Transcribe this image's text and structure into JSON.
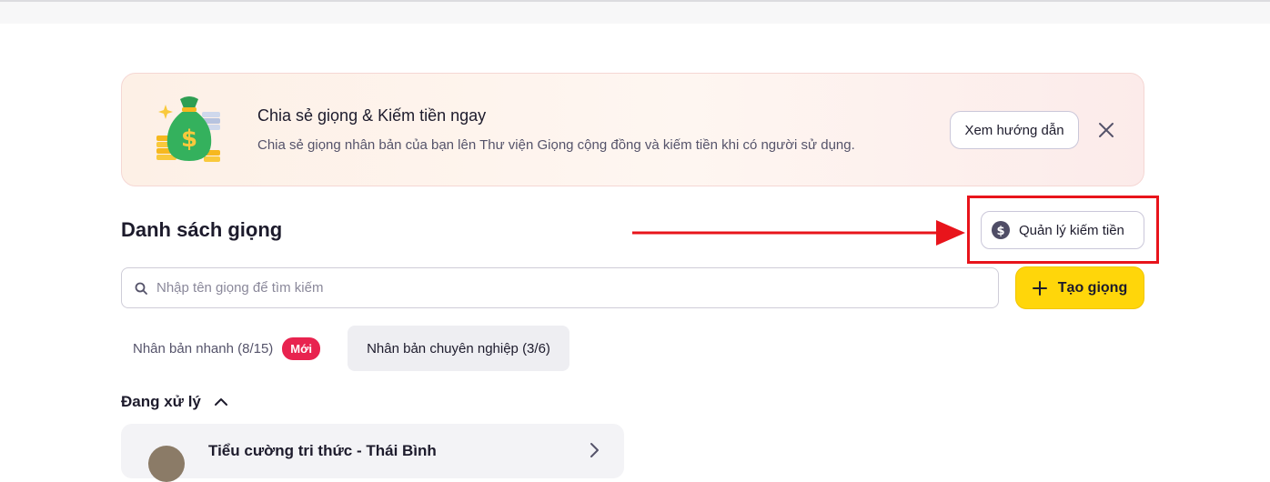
{
  "banner": {
    "title": "Chia sẻ giọng & Kiếm tiền ngay",
    "description": "Chia sẻ giọng nhân bản của bạn lên Thư viện Giọng cộng đồng và kiếm tiền khi có người sử dụng.",
    "guide_button": "Xem hướng dẫn",
    "icon": "money-bag-icon",
    "close_icon": "close-icon"
  },
  "section": {
    "title": "Danh sách giọng",
    "earn_button": "Quản lý kiếm tiền",
    "earn_icon": "dollar-circle-icon"
  },
  "search": {
    "placeholder": "Nhập tên giọng để tìm kiếm",
    "value": ""
  },
  "create_button": "Tạo giọng",
  "tabs": [
    {
      "label": "Nhân bản nhanh (8/15)",
      "badge": "Mới",
      "active": false
    },
    {
      "label": "Nhân bản chuyên nghiệp (3/6)",
      "active": true
    }
  ],
  "processing": {
    "label": "Đang xử lý",
    "items": [
      {
        "name": "Tiểu cường tri thức - Thái Bình"
      }
    ]
  },
  "annotation": {
    "color": "#e8141b"
  },
  "colors": {
    "accent_yellow": "#ffd60a",
    "badge_red": "#e8234f",
    "text_dark": "#1d1b2c"
  }
}
